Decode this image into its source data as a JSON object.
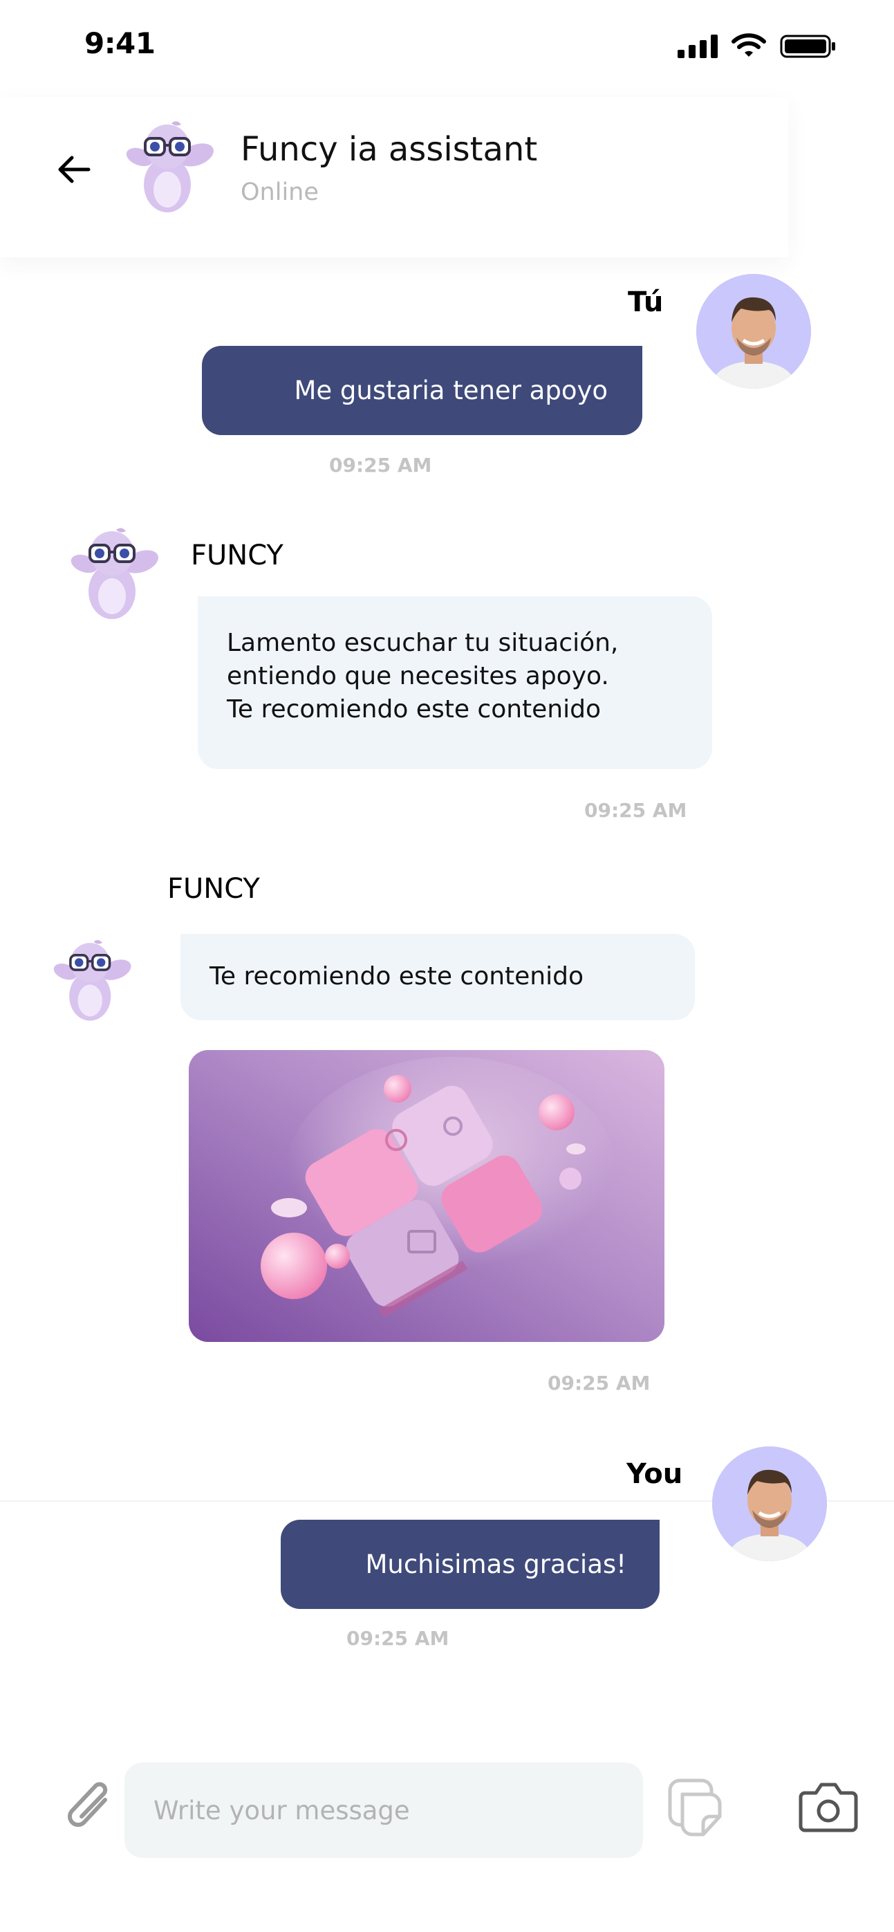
{
  "status_bar": {
    "time": "9:41"
  },
  "header": {
    "title": "Funcy ia assistant",
    "status": "Online"
  },
  "messages": [
    {
      "sender": "Tú",
      "text": "Me gustaria tener apoyo",
      "time": "09:25 AM"
    },
    {
      "sender": "FUNCY",
      "lines": [
        "Lamento escuchar tu situación,",
        "entiendo que necesites apoyo.",
        "Te recomiendo este contenido"
      ],
      "time": "09:25 AM"
    },
    {
      "sender": "FUNCY",
      "text": "Te recomiendo este contenido",
      "time": "09:25 AM"
    },
    {
      "sender": "You",
      "text": "Muchisimas gracias!",
      "time": "09:25 AM"
    }
  ],
  "composer": {
    "placeholder": "Write your message"
  },
  "icons": [
    "back-arrow-icon",
    "attach-icon",
    "sticker-icon",
    "camera-icon",
    "signal-icon",
    "wifi-icon",
    "battery-icon"
  ],
  "colors": {
    "outgoing_bubble": "#3f4a7a",
    "incoming_bubble": "#f0f5fa",
    "avatar_bg": "#c9c7fb",
    "mascot": "#d8c4ee"
  }
}
